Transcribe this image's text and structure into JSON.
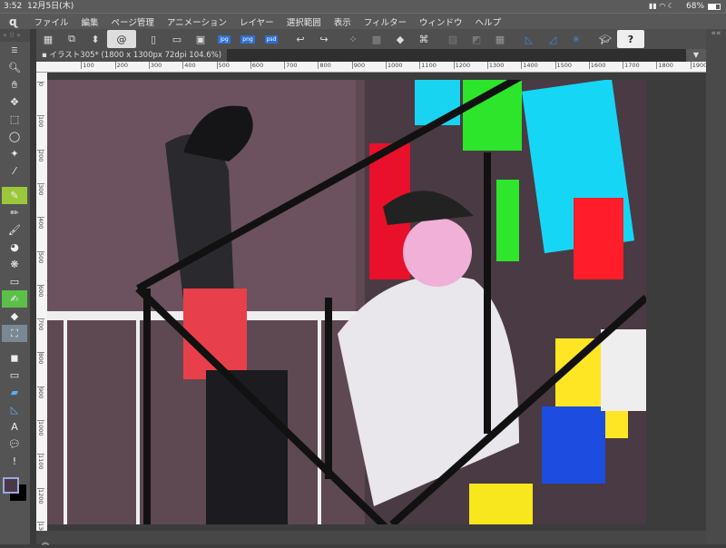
{
  "status": {
    "time": "3:52",
    "date": "12月5日(木)",
    "battery": "68%"
  },
  "menu": {
    "items": [
      "ファイル",
      "編集",
      "ページ管理",
      "アニメーション",
      "レイヤー",
      "選択範囲",
      "表示",
      "フィルター",
      "ウィンドウ",
      "ヘルプ"
    ]
  },
  "toolbar": {
    "icons": [
      "grid-icon",
      "screen-capture-icon",
      "up-down-icon",
      "spiral-icon",
      "new-file-icon",
      "open-folder-icon",
      "save-icon",
      "export-jpg-icon",
      "export-png-icon",
      "export-psd-icon",
      "undo-icon",
      "redo-icon",
      "dots-icon",
      "layer-icon",
      "fill-icon",
      "transform-icon",
      "clear-icon",
      "gray-icon",
      "select-grid-icon",
      "ruler-pen-icon",
      "ruler-shape-icon",
      "ruler-snap-icon",
      "learn-icon",
      "help-icon"
    ],
    "formats": [
      "jpg",
      "png",
      "psd"
    ]
  },
  "document": {
    "tab_title": "イラスト305* (1800 x 1300px 72dpi 104.6%)"
  },
  "ruler": {
    "h_labels": [
      "100",
      "200",
      "300",
      "400",
      "500",
      "600",
      "700",
      "800",
      "900",
      "1000",
      "1100",
      "1200",
      "1300",
      "1400",
      "1500",
      "1600",
      "1700",
      "1800",
      "1900"
    ],
    "v_labels": [
      "0",
      "100",
      "200",
      "300",
      "400",
      "500",
      "600",
      "700",
      "800",
      "900",
      "1000",
      "1100",
      "1200",
      "1300"
    ]
  },
  "tools": [
    "zoom-icon",
    "hand-icon",
    "move-icon",
    "select-object-icon",
    "lasso-icon",
    "auto-select-icon",
    "eyedropper-icon",
    "pen-icon",
    "pencil-icon",
    "brush-icon",
    "airbrush-icon",
    "decoration-icon",
    "eraser-icon",
    "blend-icon",
    "figure-icon",
    "fill-tool-icon",
    "gradient-icon",
    "rectangle-icon",
    "frame-icon",
    "ruler-icon",
    "text-icon",
    "balloon-icon",
    "correct-line-icon"
  ],
  "colors": {
    "main": "#4a3848",
    "sub": "#000000",
    "accent": "#3a8ad8"
  }
}
